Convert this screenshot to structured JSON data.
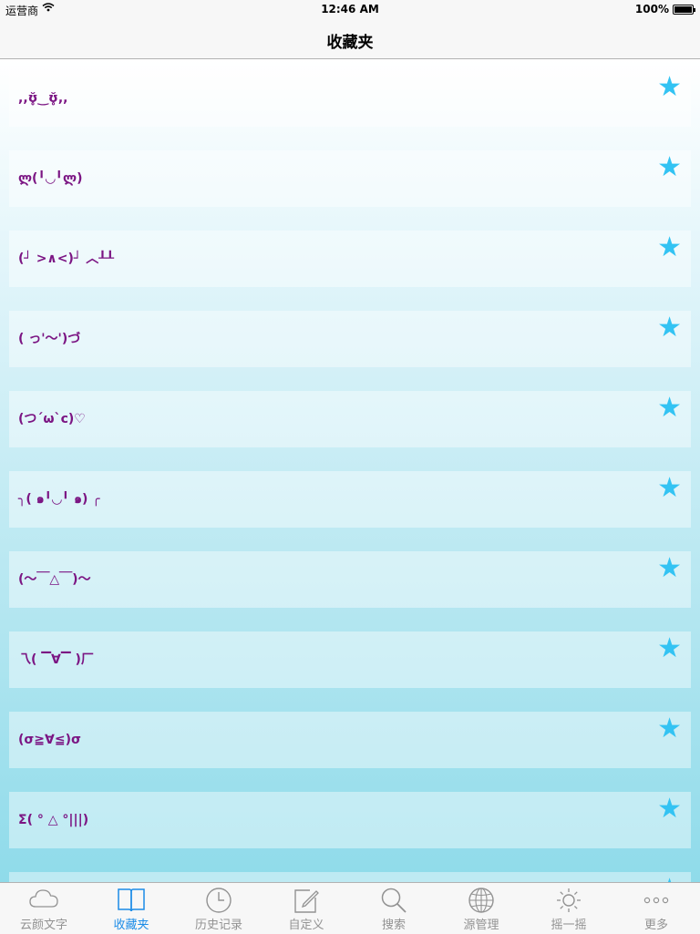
{
  "status_bar": {
    "carrier": "运营商",
    "time": "12:46 AM",
    "battery": "100%"
  },
  "nav": {
    "title": "收藏夹"
  },
  "favorites": [
    {
      "text": ",,ʊ̥̆‿ʊ̥̆,,",
      "starred": true
    },
    {
      "text": "ლ(╹◡╹ლ)",
      "starred": true
    },
    {
      "text": "(┘ >∧<)┘ ︿┸┸",
      "starred": true
    },
    {
      "text": "( っ'～')づ",
      "starred": true
    },
    {
      "text": "(つ´ω`c)♡",
      "starred": true
    },
    {
      "text": "╮( ๑╹◡╹ ๑) ╭",
      "starred": true
    },
    {
      "text": "(～￣△￣)～",
      "starred": true
    },
    {
      "text": "乁( ▔∀▔ )厂",
      "starred": true
    },
    {
      "text": "(σ≧∀≦)σ",
      "starred": true
    },
    {
      "text": "Σ( ° △ °|||)",
      "starred": true
    },
    {
      "text": "",
      "starred": true
    }
  ],
  "tabs": [
    {
      "label": "云颜文字",
      "icon": "cloud-icon",
      "active": false
    },
    {
      "label": "收藏夹",
      "icon": "book-icon",
      "active": true
    },
    {
      "label": "历史记录",
      "icon": "clock-icon",
      "active": false
    },
    {
      "label": "自定义",
      "icon": "edit-icon",
      "active": false
    },
    {
      "label": "搜索",
      "icon": "search-icon",
      "active": false
    },
    {
      "label": "源管理",
      "icon": "globe-icon",
      "active": false
    },
    {
      "label": "摇一摇",
      "icon": "sun-icon",
      "active": false
    },
    {
      "label": "更多",
      "icon": "more-icon",
      "active": false
    }
  ],
  "colors": {
    "accent": "#1c8ce7",
    "star": "#33c3f3",
    "emoticon": "#7b1583"
  }
}
